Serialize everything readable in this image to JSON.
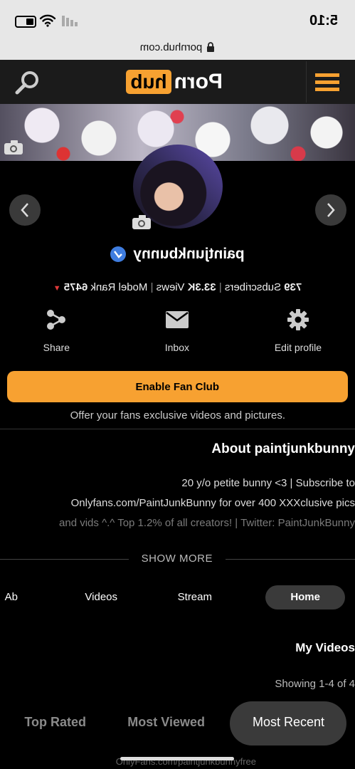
{
  "status_bar": {
    "time": "5:10"
  },
  "browser": {
    "url": "pornhub.com"
  },
  "header": {
    "logo_left": "Porn",
    "logo_right": "hub"
  },
  "profile": {
    "username": "paintjunkbunny",
    "rank_label": "Model Rank",
    "rank": "6475",
    "views": "33.3K",
    "views_label": "Views",
    "subscribers": "739",
    "subscribers_label": "Subscribers"
  },
  "actions": {
    "edit_profile": "Edit profile",
    "inbox": "Inbox",
    "share": "Share"
  },
  "fan_club": {
    "button_label": "Enable Fan Club",
    "caption": "Offer your fans exclusive videos and pictures."
  },
  "about": {
    "heading": "About paintjunkbunny",
    "lines": [
      "20 y/o petite bunny <3 | Subscribe to",
      "Onlyfans.com/PaintJunkBunny for over 400 XXXclusive pics",
      "and vids ^.^ Top 1.2% of all creators! | Twitter: PaintJunkBunny"
    ],
    "show_more": "SHOW MORE"
  },
  "tabs": [
    "Home",
    "Stream",
    "Videos",
    "Ab"
  ],
  "my_videos": {
    "heading": "My Videos",
    "showing": "Showing 1-4 of 4",
    "sort_options": [
      "Most Recent",
      "Most Viewed",
      "Top Rated"
    ],
    "active_sort": "Most Recent",
    "footer_link": "OnlyFans.com/paintjunkbunnyfree"
  },
  "colors": {
    "accent": "#f7a131",
    "verified": "#3f7de0",
    "rank_arrow": "#e03a3a"
  }
}
